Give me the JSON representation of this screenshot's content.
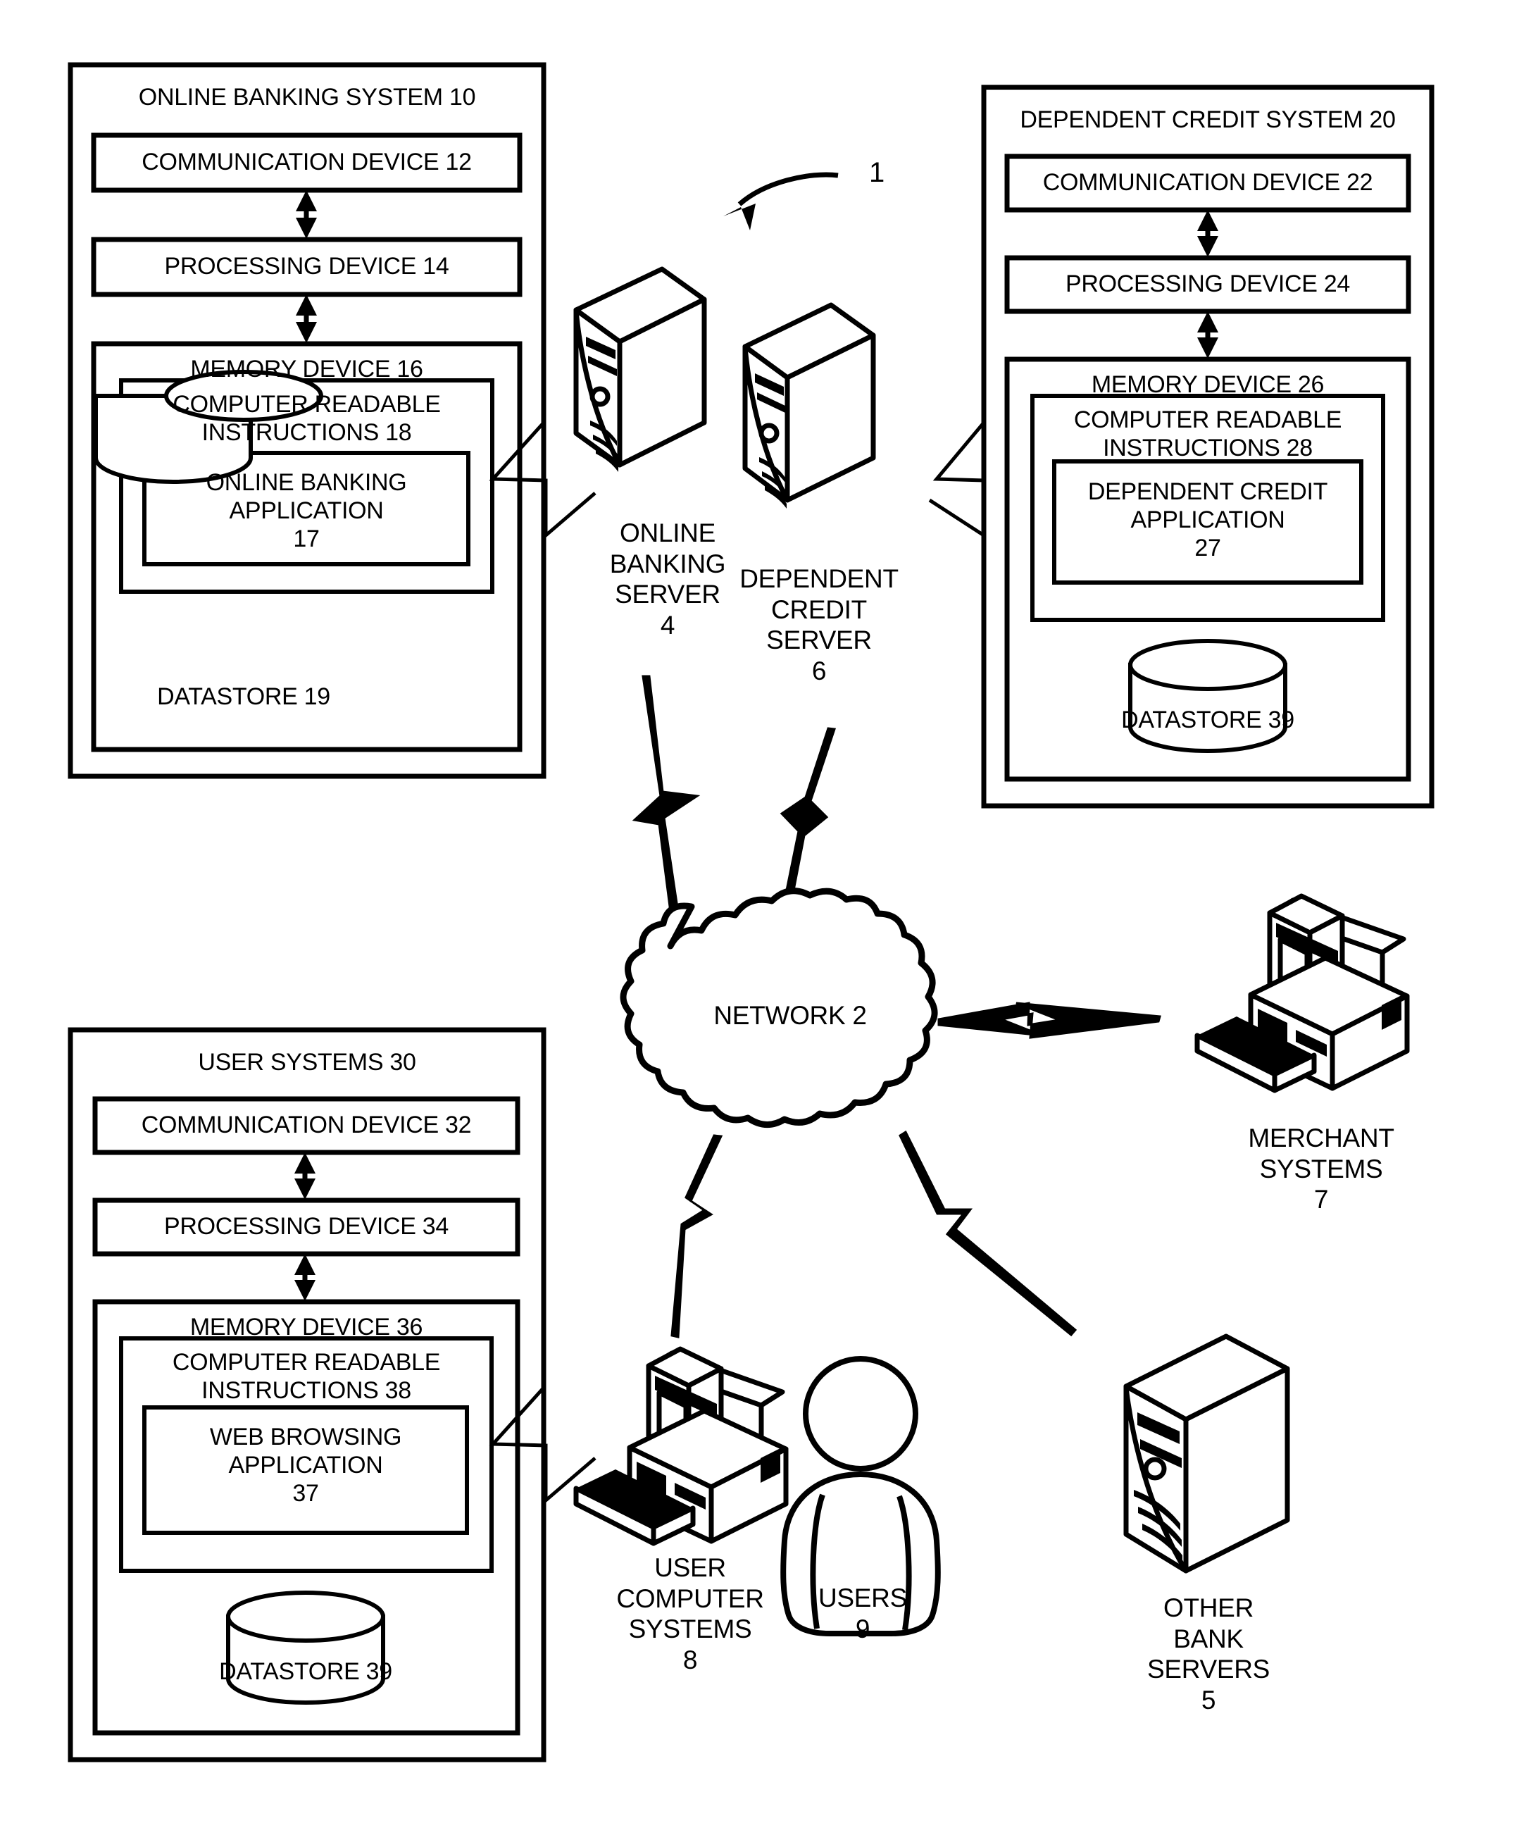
{
  "figure": {
    "reference_numeral": "1"
  },
  "systems": {
    "online_banking": {
      "title": "ONLINE BANKING SYSTEM 10",
      "communication_device": "COMMUNICATION DEVICE 12",
      "processing_device": "PROCESSING DEVICE 14",
      "memory_device": "MEMORY DEVICE 16",
      "instructions": "COMPUTER READABLE\nINSTRUCTIONS 18",
      "application": "ONLINE BANKING\nAPPLICATION\n17",
      "datastore": "DATASTORE 19"
    },
    "dependent_credit": {
      "title": "DEPENDENT CREDIT SYSTEM 20",
      "communication_device": "COMMUNICATION DEVICE 22",
      "processing_device": "PROCESSING DEVICE 24",
      "memory_device": "MEMORY DEVICE 26",
      "instructions": "COMPUTER READABLE\nINSTRUCTIONS 28",
      "application": "DEPENDENT CREDIT\nAPPLICATION\n27",
      "datastore": "DATASTORE 39"
    },
    "user_systems": {
      "title": "USER SYSTEMS 30",
      "communication_device": "COMMUNICATION DEVICE 32",
      "processing_device": "PROCESSING DEVICE 34",
      "memory_device": "MEMORY DEVICE 36",
      "instructions": "COMPUTER READABLE\nINSTRUCTIONS 38",
      "application": "WEB BROWSING\nAPPLICATION\n37",
      "datastore": "DATASTORE 39"
    }
  },
  "nodes": {
    "online_banking_server": "ONLINE\nBANKING\nSERVER\n4",
    "dependent_credit_server": "DEPENDENT\nCREDIT\nSERVER\n6",
    "network": "NETWORK 2",
    "merchant_systems": "MERCHANT\nSYSTEMS\n7",
    "user_computer_systems": "USER\nCOMPUTER\nSYSTEMS\n8",
    "users": "USERS\n9",
    "other_bank_servers": "OTHER\nBANK\nSERVERS\n5"
  },
  "colors": {
    "ink": "#000000",
    "paper": "#ffffff"
  }
}
